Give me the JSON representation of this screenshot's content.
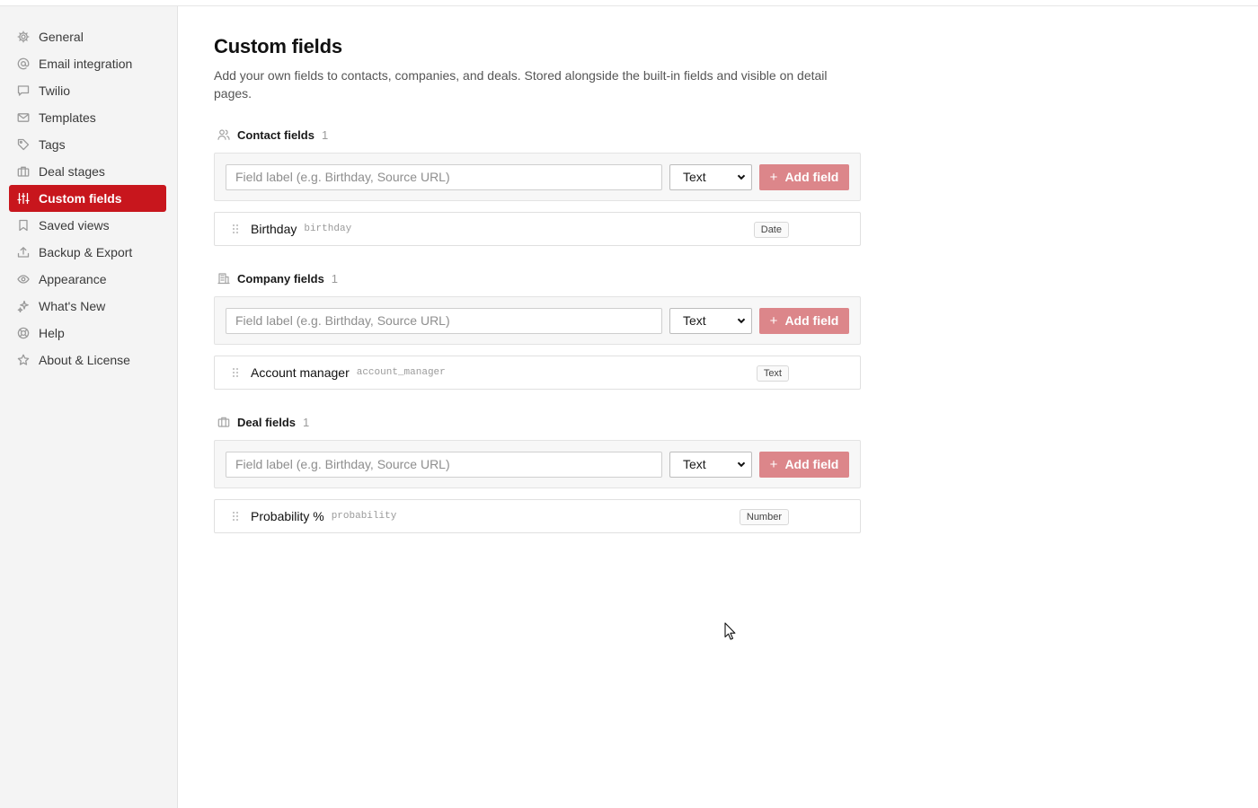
{
  "sidebar": {
    "items": [
      {
        "label": "General",
        "icon": "gear-icon"
      },
      {
        "label": "Email integration",
        "icon": "at-sign-icon"
      },
      {
        "label": "Twilio",
        "icon": "chat-bubble-icon"
      },
      {
        "label": "Templates",
        "icon": "envelope-icon"
      },
      {
        "label": "Tags",
        "icon": "tag-icon"
      },
      {
        "label": "Deal stages",
        "icon": "briefcase-icon"
      },
      {
        "label": "Custom fields",
        "icon": "sliders-icon",
        "active": true
      },
      {
        "label": "Saved views",
        "icon": "bookmark-icon"
      },
      {
        "label": "Backup & Export",
        "icon": "upload-icon"
      },
      {
        "label": "Appearance",
        "icon": "eye-icon"
      },
      {
        "label": "What's New",
        "icon": "sparkle-icon"
      },
      {
        "label": "Help",
        "icon": "lifebuoy-icon"
      },
      {
        "label": "About & License",
        "icon": "star-icon"
      }
    ]
  },
  "main": {
    "title": "Custom fields",
    "description": "Add your own fields to contacts, companies, and deals. Stored alongside the built-in fields and visible on detail pages.",
    "sections": [
      {
        "title": "Contact fields",
        "count": "1",
        "icon": "users-icon",
        "input_placeholder": "Field label (e.g. Birthday, Source URL)",
        "type_value": "Text",
        "add_label": "Add field",
        "fields": [
          {
            "name": "Birthday",
            "key": "birthday",
            "type": "Date"
          }
        ]
      },
      {
        "title": "Company fields",
        "count": "1",
        "icon": "building-icon",
        "input_placeholder": "Field label (e.g. Birthday, Source URL)",
        "type_value": "Text",
        "add_label": "Add field",
        "fields": [
          {
            "name": "Account manager",
            "key": "account_manager",
            "type": "Text"
          }
        ]
      },
      {
        "title": "Deal fields",
        "count": "1",
        "icon": "briefcase-icon",
        "input_placeholder": "Field label (e.g. Birthday, Source URL)",
        "type_value": "Text",
        "add_label": "Add field",
        "fields": [
          {
            "name": "Probability %",
            "key": "probability",
            "type": "Number"
          }
        ]
      }
    ]
  },
  "colors": {
    "accent": "#c8161d",
    "add_button": "#dc868a"
  }
}
